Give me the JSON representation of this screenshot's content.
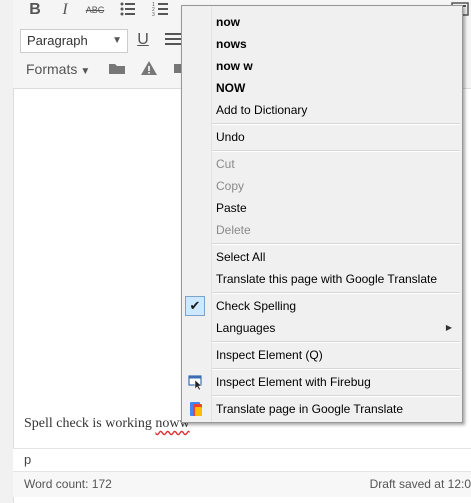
{
  "toolbar": {
    "paragraph_select": "Paragraph",
    "formats_label": "Formats"
  },
  "editor": {
    "text_before": "Spell check is working ",
    "misspelled": "noww"
  },
  "path_bar": {
    "element": "p"
  },
  "status": {
    "word_count": "Word count: 172",
    "draft": "Draft saved at 12:0"
  },
  "context_menu": {
    "suggestions": [
      "now",
      "nows",
      "now w",
      "NOW"
    ],
    "add_to_dictionary": "Add to Dictionary",
    "undo": "Undo",
    "cut": "Cut",
    "copy": "Copy",
    "paste": "Paste",
    "delete": "Delete",
    "select_all": "Select All",
    "translate_page": "Translate this page with Google Translate",
    "check_spelling": "Check Spelling",
    "languages": "Languages",
    "inspect_element": "Inspect Element (Q)",
    "inspect_firebug": "Inspect Element with Firebug",
    "translate_google": "Translate page in Google Translate"
  },
  "icons": {
    "check": "checkmark-icon",
    "firebug": "firebug-inspect-icon",
    "translate": "google-translate-icon",
    "submenu": "submenu-arrow-icon"
  }
}
